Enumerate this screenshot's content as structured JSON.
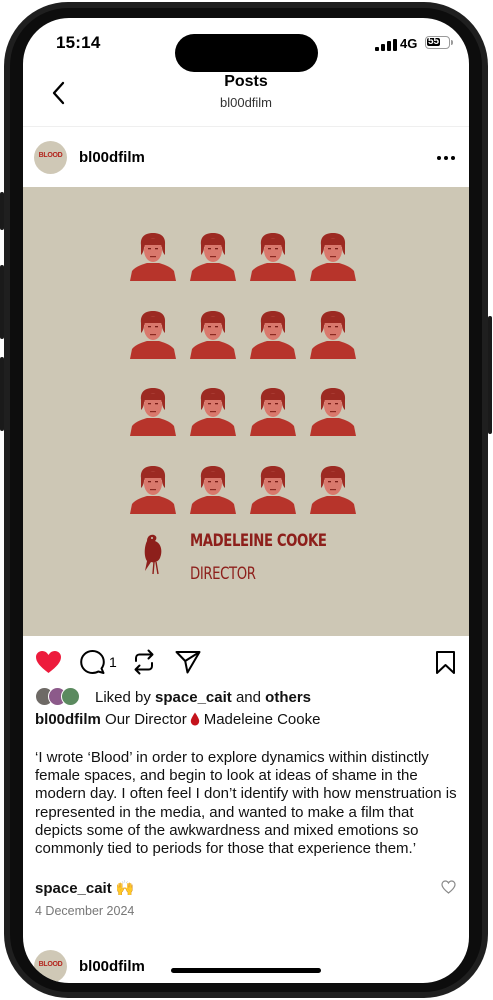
{
  "status_bar": {
    "time": "15:14",
    "network": "4G",
    "battery": "55"
  },
  "header": {
    "title": "Posts",
    "subtitle": "bl00dfilm"
  },
  "post": {
    "username": "bl00dfilm",
    "avatar_label": "BLOOD",
    "image": {
      "credit_name": "MADELEINE COOKE",
      "credit_role": "DIRECTOR"
    },
    "comment_count": "1",
    "liked_prefix": "Liked by",
    "liked_user": "space_cait",
    "liked_and": "and",
    "liked_others": "others",
    "caption_user": "bl00dfilm",
    "caption_before": "Our Director",
    "caption_after": "Madeleine Cooke",
    "quote": "‘I wrote ‘Blood’ in order to explore dynamics within distinctly female spaces, and begin to look at ideas of shame in the modern day. I often feel I don’t identify with how menstruation is represented in the media, and wanted to make a film that depicts some of the awkwardness and mixed emotions so commonly tied to periods for those that experience them.’",
    "comment_user": "space_cait",
    "comment_emoji": "🙌",
    "date": "4 December 2024"
  },
  "next_post": {
    "username": "bl00dfilm",
    "avatar_label": "BLOOD"
  },
  "colors": {
    "like": "#ed1b3c",
    "image_bg": "#cdc7b5",
    "blood_red": "#8d1f1b"
  },
  "icons": [
    "back-icon",
    "more-icon",
    "heart-icon",
    "comment-icon",
    "repost-icon",
    "share-icon",
    "bookmark-icon",
    "blood-drop-icon",
    "small-heart-icon"
  ]
}
